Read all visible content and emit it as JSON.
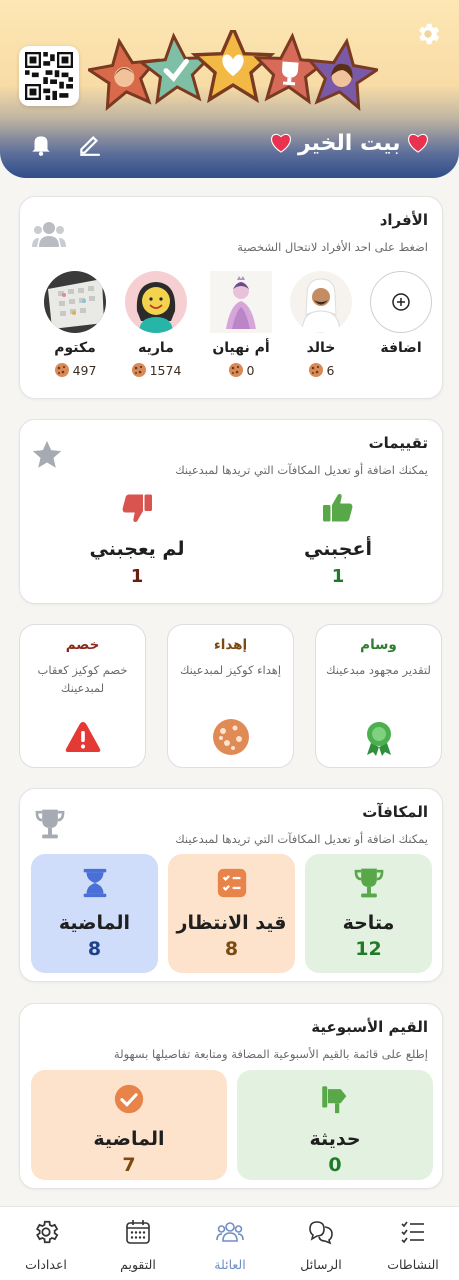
{
  "header": {
    "family_name": "بيت الخير"
  },
  "members_card": {
    "title": "الأفراد",
    "subtitle": "اضغط على احد الأفراد لانتحال الشخصية",
    "add_label": "اضافة",
    "members": [
      {
        "name": "خالد",
        "points": "6"
      },
      {
        "name": "أم نهيان",
        "points": "0"
      },
      {
        "name": "ماريه",
        "points": "1574"
      },
      {
        "name": "مكتوم",
        "points": "497"
      }
    ]
  },
  "ratings_card": {
    "title": "تقييمات",
    "subtitle": "يمكنك اضافة أو تعديل المكافآت التي تريدها لمبدعينك",
    "like": {
      "label": "أعجبني",
      "count": "1"
    },
    "dislike": {
      "label": "لم يعجبني",
      "count": "1"
    }
  },
  "actions": {
    "medal": {
      "title": "وسام",
      "desc": "لتقدير مجهود مبدعينك"
    },
    "gift": {
      "title": "إهداء",
      "desc": "إهداء كوكيز لمبدعينك"
    },
    "deduct": {
      "title": "خصم",
      "desc": "خصم كوكيز كعقاب لمبدعينك"
    }
  },
  "rewards_card": {
    "title": "المكافآت",
    "subtitle": "يمكنك اضافة أو تعديل المكافآت التي تريدها لمبدعينك",
    "available": {
      "label": "متاحة",
      "count": "12"
    },
    "pending": {
      "label": "قيد الانتظار",
      "count": "8"
    },
    "past": {
      "label": "الماضية",
      "count": "8"
    }
  },
  "weekly_card": {
    "title": "القيم الأسبوعية",
    "subtitle": "إطلع على قائمة بالقيم الأسبوعية المضافة ومتابعة تفاصيلها بسهولة",
    "new": {
      "label": "حديثة",
      "count": "0"
    },
    "past": {
      "label": "الماضية",
      "count": "7"
    }
  },
  "nav": {
    "activities": "النشاطات",
    "messages": "الرسائل",
    "family": "العائلة",
    "calendar": "التقويم",
    "settings": "اعدادات"
  },
  "colors": {
    "accent": "#6f8fc6",
    "green": "#1f7a2a",
    "dark_red": "#6b1d12",
    "brown": "#7a4a12",
    "navy": "#1f3f8a"
  }
}
